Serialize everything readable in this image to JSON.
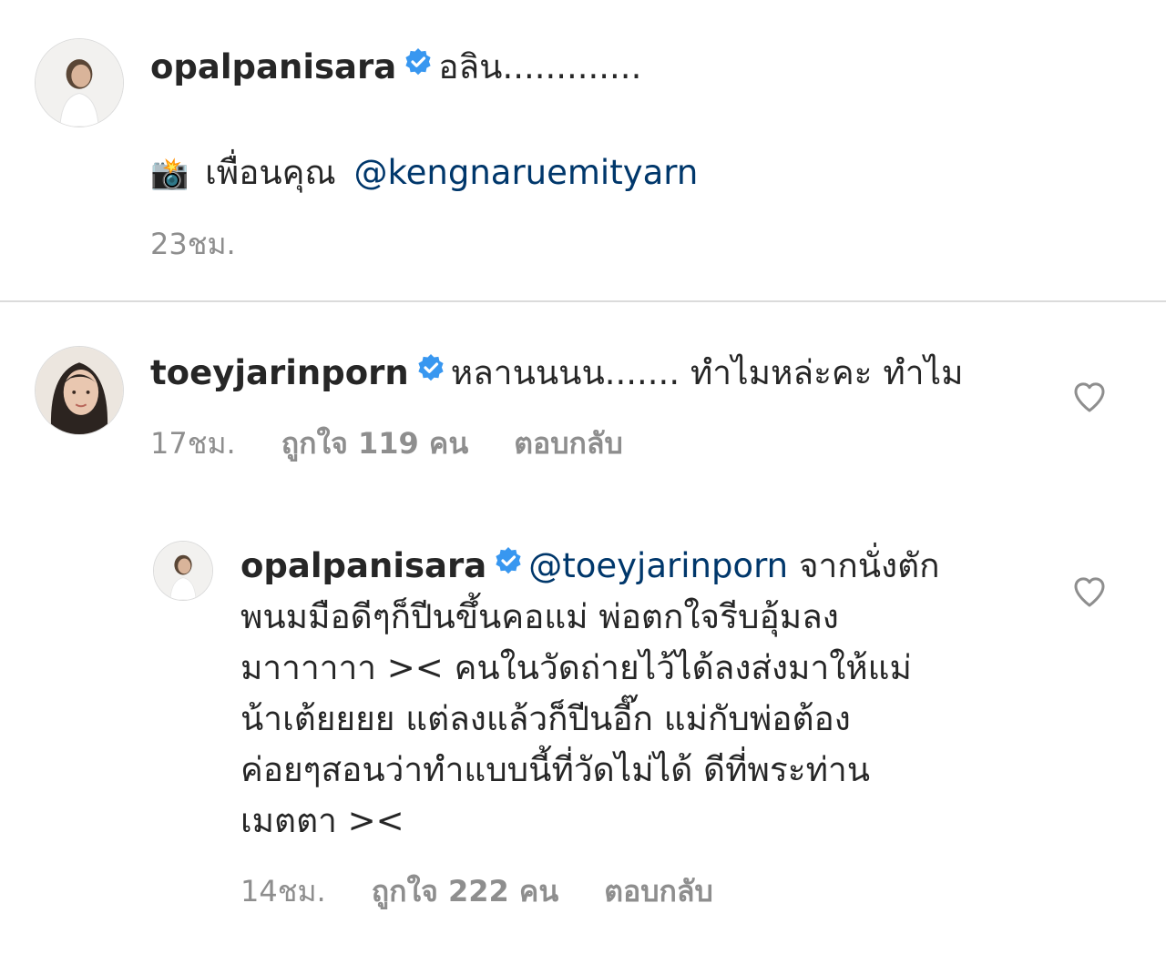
{
  "caption": {
    "username": "opalpanisara",
    "text": "อลิน.............",
    "emoji": "📸",
    "line2_text": "เพื่อนคุณ",
    "line2_mention": "@kengnaruemityarn",
    "time": "23ชม."
  },
  "comment1": {
    "username": "toeyjarinporn",
    "text": "หลานนนน....... ทำไมหล่ะคะ ทำไม",
    "time": "17ชม.",
    "likes": "ถูกใจ 119 คน",
    "reply": "ตอบกลับ"
  },
  "reply1": {
    "username": "opalpanisara",
    "mention": "@toeyjarinporn",
    "lines": [
      "จากนั่งตัก",
      "พนมมือดีๆก็ปีนขึ้นคอแม่ พ่อตกใจรีบอุ้มลง",
      "มาาาาาา >< คนในวัดถ่ายไว้ได้ลงส่งมาให้แม่",
      "น้าเต้ยยยย แต่ลงแล้วก็ปีนอี๊ก แม่กับพ่อต้อง",
      "ค่อยๆสอนว่าทำแบบนี้ที่วัดไม่ได้ ดีที่พระท่าน",
      "เมตตา ><"
    ],
    "time": "14ชม.",
    "likes": "ถูกใจ 222 คน",
    "reply": "ตอบกลับ"
  },
  "colors": {
    "verified": "#3897f0",
    "mention": "#00376b",
    "meta": "#8e8e8e",
    "divider": "#dbdbdb"
  },
  "icons": {
    "verified": "verified-badge-icon",
    "like": "heart-outline-icon"
  }
}
